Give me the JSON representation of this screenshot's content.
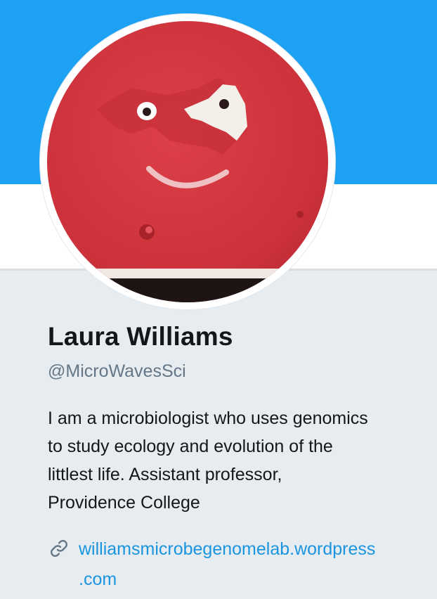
{
  "profile": {
    "name": "Laura Williams",
    "handle": "@MicroWavesSci",
    "bio_lines": [
      "I am a microbiologist who uses genomics",
      "to study ecology and evolution of the",
      "littlest life. Assistant professor,",
      "Providence College"
    ],
    "website_lines": [
      "williamsmicrobegenomelab.wordpress",
      ".com"
    ]
  },
  "colors": {
    "banner": "#1da1f2",
    "link": "#1b95e0",
    "page_background": "#e6ecf0",
    "avatar_red": "#d0363f"
  },
  "icons": {
    "website": "link-icon"
  }
}
